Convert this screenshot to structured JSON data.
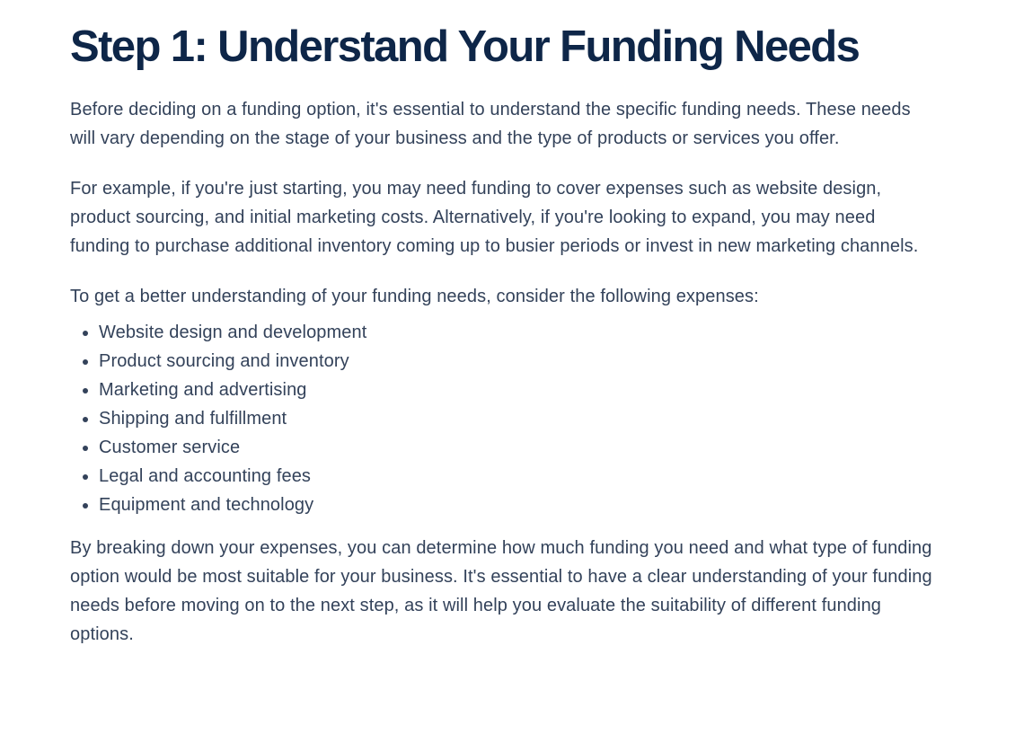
{
  "article": {
    "heading": "Step 1: Understand Your Funding Needs",
    "paragraphs": [
      "Before deciding on a funding option, it's essential to understand the specific funding needs. These needs will vary depending on the stage of your business and the type of products or services you offer.",
      "For example, if you're just starting, you may need funding to cover expenses such as website design, product sourcing, and initial marketing costs. Alternatively, if you're looking to expand, you may need funding to purchase additional inventory coming up to busier periods or invest in new marketing channels.",
      "To get a better understanding of your funding needs, consider the following expenses:"
    ],
    "expenses": [
      "Website design and development",
      "Product sourcing and inventory",
      "Marketing and advertising",
      "Shipping and fulfillment",
      "Customer service",
      "Legal and accounting fees",
      "Equipment and technology"
    ],
    "closing": "By breaking down your expenses, you can determine how much funding you need and what type of funding option would be most suitable for your business. It's essential to have a clear understanding of your funding needs before moving on to the next step, as it will help you evaluate the suitability of different funding options."
  },
  "colors": {
    "heading": "#0e2648",
    "body_text": "#33425a",
    "background": "#ffffff"
  }
}
